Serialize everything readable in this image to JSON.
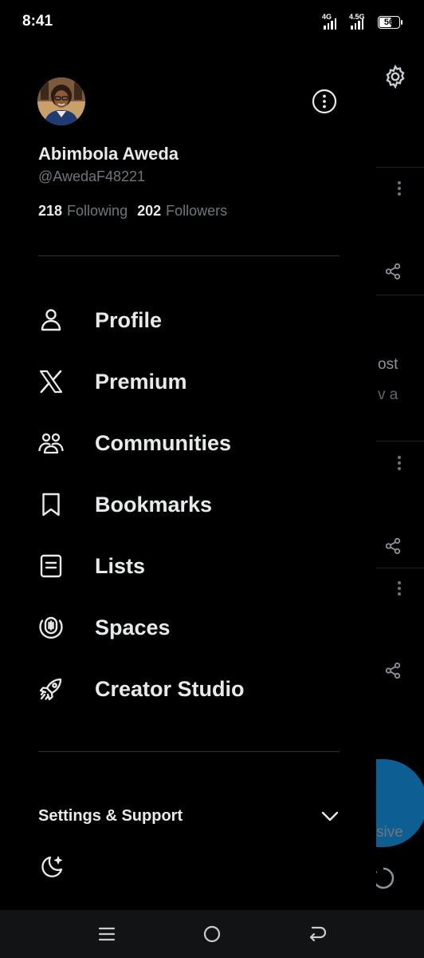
{
  "status_bar": {
    "time": "8:41",
    "signal_1_label": "4G",
    "signal_2_label": "4.5G",
    "battery_level": "56"
  },
  "profile": {
    "name": "Abimbola Aweda",
    "handle": "@AwedaF48221",
    "following_count": "218",
    "following_label": "Following",
    "followers_count": "202",
    "followers_label": "Followers"
  },
  "menu": {
    "items": [
      {
        "label": "Profile",
        "icon": "person-icon"
      },
      {
        "label": "Premium",
        "icon": "x-logo-icon"
      },
      {
        "label": "Communities",
        "icon": "communities-icon"
      },
      {
        "label": "Bookmarks",
        "icon": "bookmark-icon"
      },
      {
        "label": "Lists",
        "icon": "list-icon"
      },
      {
        "label": "Spaces",
        "icon": "spaces-icon"
      },
      {
        "label": "Creator Studio",
        "icon": "rocket-icon"
      }
    ]
  },
  "settings": {
    "label": "Settings & Support"
  },
  "background_timeline": {
    "text_1": "ost",
    "text_2": "v a",
    "text_3": "sive"
  },
  "colors": {
    "background": "#000000",
    "primary_text": "#e7e9ea",
    "secondary_text": "#71767b",
    "divider": "#2f3336",
    "fab": "#1d9bf0"
  }
}
